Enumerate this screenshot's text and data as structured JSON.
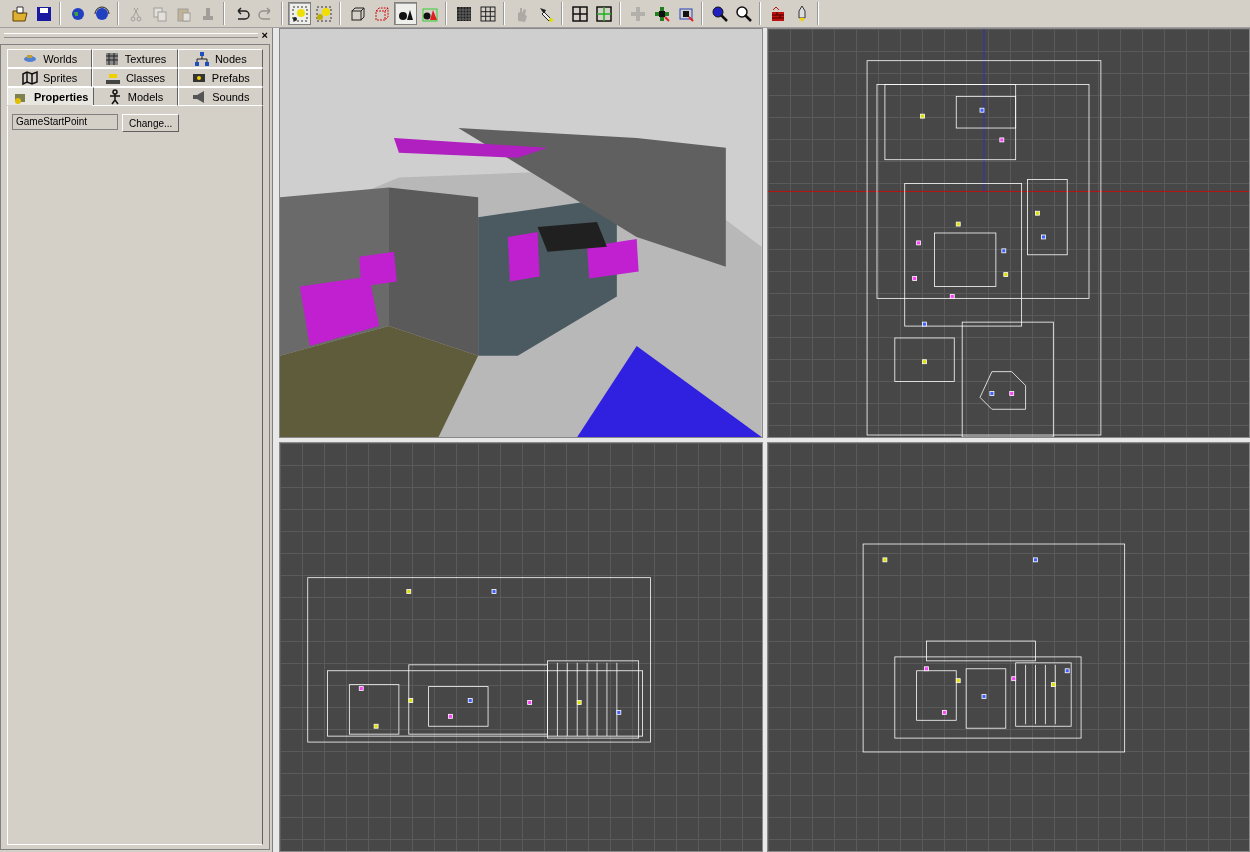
{
  "toolbar": {
    "groups": [
      [
        {
          "kind": "open",
          "pressed": false,
          "disabled": false
        },
        {
          "kind": "save",
          "pressed": false,
          "disabled": false
        }
      ],
      [
        {
          "kind": "globe",
          "pressed": false,
          "disabled": false
        },
        {
          "kind": "globe-refresh",
          "pressed": false,
          "disabled": false
        }
      ],
      [
        {
          "kind": "cut",
          "pressed": false,
          "disabled": true
        },
        {
          "kind": "copy",
          "pressed": false,
          "disabled": true
        },
        {
          "kind": "paste",
          "pressed": false,
          "disabled": true
        },
        {
          "kind": "stamp",
          "pressed": false,
          "disabled": true
        }
      ],
      [
        {
          "kind": "undo",
          "pressed": false,
          "disabled": false
        },
        {
          "kind": "redo",
          "pressed": false,
          "disabled": true
        }
      ],
      [
        {
          "kind": "select-point",
          "pressed": true,
          "disabled": false
        },
        {
          "kind": "select-multi",
          "pressed": false,
          "disabled": false
        }
      ],
      [
        {
          "kind": "wire-cube",
          "pressed": false,
          "disabled": false
        },
        {
          "kind": "dashed-cube",
          "pressed": false,
          "disabled": false
        },
        {
          "kind": "solid-shapes",
          "pressed": true,
          "disabled": false
        },
        {
          "kind": "textured-shapes",
          "pressed": false,
          "disabled": false
        }
      ],
      [
        {
          "kind": "grid-dense",
          "pressed": false,
          "disabled": false
        },
        {
          "kind": "grid-sparse",
          "pressed": false,
          "disabled": false
        }
      ],
      [
        {
          "kind": "hand",
          "pressed": false,
          "disabled": true
        },
        {
          "kind": "tool",
          "pressed": false,
          "disabled": false
        }
      ],
      [
        {
          "kind": "layout",
          "pressed": false,
          "disabled": false
        },
        {
          "kind": "layout-cross",
          "pressed": false,
          "disabled": false
        }
      ],
      [
        {
          "kind": "add",
          "pressed": false,
          "disabled": true
        },
        {
          "kind": "add-block",
          "pressed": false,
          "disabled": false
        },
        {
          "kind": "move",
          "pressed": false,
          "disabled": false
        }
      ],
      [
        {
          "kind": "zoom-filled",
          "pressed": false,
          "disabled": false
        },
        {
          "kind": "zoom",
          "pressed": false,
          "disabled": false
        }
      ],
      [
        {
          "kind": "brick",
          "pressed": false,
          "disabled": false
        },
        {
          "kind": "rocket",
          "pressed": false,
          "disabled": false
        }
      ]
    ]
  },
  "panel": {
    "close": "×",
    "tab_rows": [
      [
        {
          "label": "Worlds",
          "selected": false
        },
        {
          "label": "Textures",
          "selected": false
        },
        {
          "label": "Nodes",
          "selected": false
        }
      ],
      [
        {
          "label": "Sprites",
          "selected": false
        },
        {
          "label": "Classes",
          "selected": false
        },
        {
          "label": "Prefabs",
          "selected": false
        }
      ],
      [
        {
          "label": "Properties",
          "selected": true
        },
        {
          "label": "Models",
          "selected": false
        },
        {
          "label": "Sounds",
          "selected": false
        }
      ]
    ],
    "properties": {
      "value": "GameStartPoint",
      "button": "Change..."
    }
  },
  "viewports": [
    {
      "kind": "perspective"
    },
    {
      "kind": "top"
    },
    {
      "kind": "front"
    },
    {
      "kind": "side"
    }
  ]
}
